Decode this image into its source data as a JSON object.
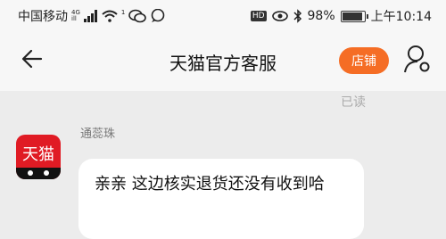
{
  "status_bar": {
    "carrier": "中国移动",
    "net_tag_top": "4G",
    "net_tag_bottom": "ill",
    "wifi_sub": "1",
    "hd_label": "HD",
    "battery_percent": "98%",
    "battery_level": 0.98,
    "time": "上午10:14"
  },
  "header": {
    "title": "天猫官方客服",
    "store_button_label": "店铺"
  },
  "chat": {
    "read_status": "已读",
    "message": {
      "sender_name": "通蕊珠",
      "avatar_text": "天猫",
      "text": "亲亲 这边核实退货还没有收到哈"
    }
  }
}
